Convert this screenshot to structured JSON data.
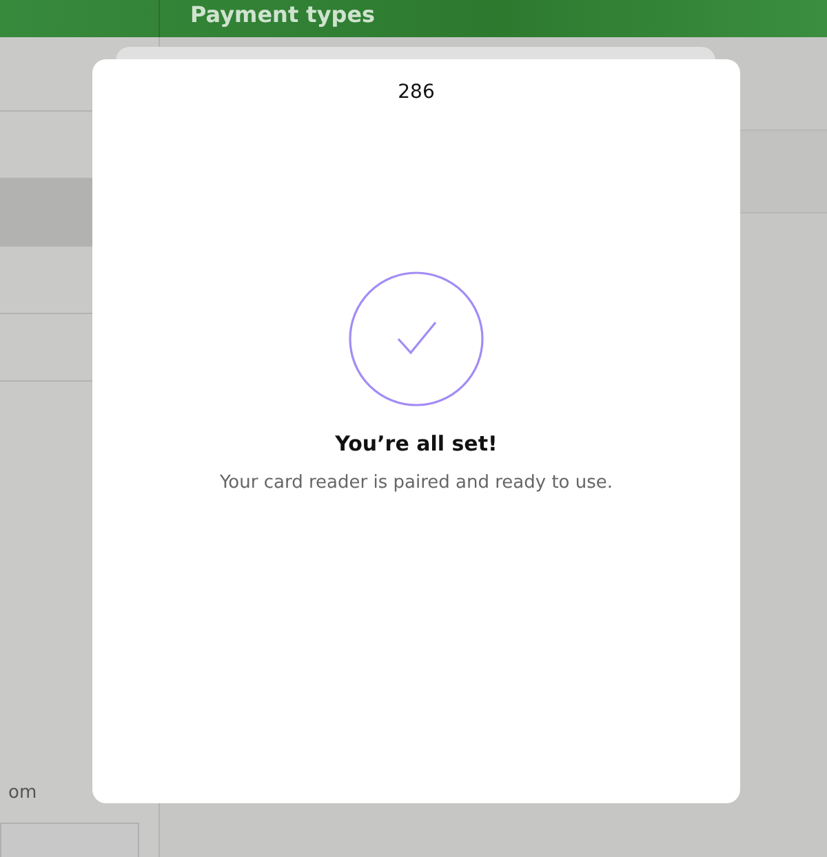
{
  "header": {
    "title": "Payment types"
  },
  "sidebar": {
    "footer_text": "om"
  },
  "dialog": {
    "title": "286",
    "heading": "You’re all set!",
    "message": "Your card reader is paired and ready to use."
  }
}
